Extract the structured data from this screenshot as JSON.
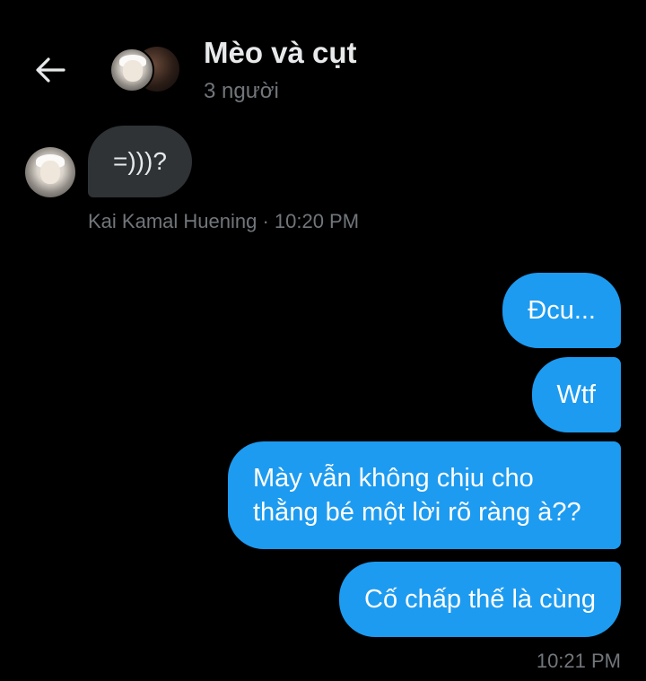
{
  "header": {
    "back_icon": "arrow-left-icon",
    "title": "Mèo và cụt",
    "subtitle": "3 người"
  },
  "messages": {
    "incoming": [
      {
        "text": "=)))?",
        "sender": "Kai Kamal Huening",
        "time": "10:20 PM",
        "meta": "Kai Kamal Huening · 10:20 PM"
      }
    ],
    "outgoing": [
      {
        "text": "Đcu..."
      },
      {
        "text": "Wtf"
      },
      {
        "text": "Mày vẫn không chịu cho thằng bé một lời rõ ràng à??"
      },
      {
        "text": "Cố chấp thế là cùng"
      }
    ],
    "outgoing_time": "10:21 PM"
  },
  "colors": {
    "background": "#000000",
    "incoming_bubble": "#2f3336",
    "outgoing_bubble": "#1d9bf0",
    "secondary_text": "#71767b",
    "primary_text": "#e7e9ea"
  }
}
